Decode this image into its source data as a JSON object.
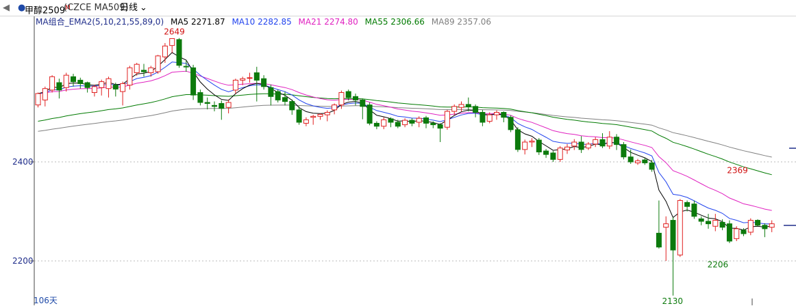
{
  "toolbar": {
    "back_icon": "triangle-left-icon",
    "symbol_name": "甲醇2509",
    "symbol_superscript": "M",
    "code": "(CZCE MA509)",
    "period": "日线",
    "dropdown_icon": "chevron-down-icon"
  },
  "legend": {
    "group_name": "MA组合_EMA2(5,10,21,55,89,0)",
    "items": [
      {
        "label": "MA5 2271.87",
        "color": "#000000"
      },
      {
        "label": "MA10 2282.85",
        "color": "#2244ee"
      },
      {
        "label": "MA21 2274.80",
        "color": "#e020c0"
      },
      {
        "label": "MA55 2306.66",
        "color": "#007a00"
      },
      {
        "label": "MA89 2357.06",
        "color": "#7f7f7f"
      }
    ]
  },
  "bottom_label": "106天",
  "colors": {
    "up": "#e02020",
    "down": "#0c7a0c",
    "grid": "#b8b8b8"
  },
  "chart_data": {
    "type": "candlestick",
    "title": "",
    "y_ticks": [
      2200,
      2400
    ],
    "grid": "dashed-horizontal",
    "annotations": [
      {
        "label": "2649",
        "value": 2649,
        "type": "high"
      },
      {
        "label": "2130",
        "value": 2130,
        "type": "low"
      },
      {
        "label": "2369",
        "value": 2369,
        "type": "high"
      },
      {
        "label": "2206",
        "value": 2206,
        "type": "low"
      }
    ],
    "candles": [
      [
        2515,
        2538,
        2510,
        2540
      ],
      [
        2525,
        2548,
        2512,
        2552
      ],
      [
        2545,
        2572,
        2540,
        2575
      ],
      [
        2560,
        2545,
        2528,
        2568
      ],
      [
        2550,
        2575,
        2542,
        2580
      ],
      [
        2572,
        2562,
        2552,
        2578
      ],
      [
        2565,
        2558,
        2548,
        2570
      ],
      [
        2560,
        2550,
        2540,
        2562
      ],
      [
        2540,
        2552,
        2532,
        2556
      ],
      [
        2550,
        2562,
        2534,
        2566
      ],
      [
        2548,
        2568,
        2530,
        2572
      ],
      [
        2555,
        2547,
        2532,
        2560
      ],
      [
        2542,
        2558,
        2514,
        2562
      ],
      [
        2555,
        2590,
        2546,
        2594
      ],
      [
        2580,
        2597,
        2574,
        2600
      ],
      [
        2585,
        2582,
        2572,
        2598
      ],
      [
        2580,
        2590,
        2572,
        2594
      ],
      [
        2582,
        2614,
        2578,
        2616
      ],
      [
        2612,
        2634,
        2600,
        2640
      ],
      [
        2635,
        2649,
        2620,
        2649
      ],
      [
        2647,
        2595,
        2590,
        2650
      ],
      [
        2593,
        2592,
        2582,
        2604
      ],
      [
        2590,
        2535,
        2525,
        2596
      ],
      [
        2540,
        2520,
        2514,
        2546
      ],
      [
        2520,
        2518,
        2506,
        2530
      ],
      [
        2514,
        2512,
        2502,
        2522
      ],
      [
        2518,
        2508,
        2485,
        2524
      ],
      [
        2510,
        2520,
        2498,
        2526
      ],
      [
        2545,
        2565,
        2538,
        2568
      ],
      [
        2565,
        2568,
        2555,
        2572
      ],
      [
        2570,
        2570,
        2560,
        2580
      ],
      [
        2580,
        2565,
        2522,
        2592
      ],
      [
        2568,
        2552,
        2546,
        2575
      ],
      [
        2550,
        2532,
        2514,
        2556
      ],
      [
        2542,
        2525,
        2520,
        2546
      ],
      [
        2530,
        2522,
        2514,
        2542
      ],
      [
        2522,
        2505,
        2495,
        2526
      ],
      [
        2505,
        2480,
        2475,
        2512
      ],
      [
        2478,
        2485,
        2472,
        2490
      ],
      [
        2490,
        2492,
        2475,
        2495
      ],
      [
        2492,
        2496,
        2485,
        2498
      ],
      [
        2495,
        2500,
        2482,
        2504
      ],
      [
        2505,
        2515,
        2496,
        2518
      ],
      [
        2515,
        2540,
        2507,
        2544
      ],
      [
        2542,
        2530,
        2524,
        2546
      ],
      [
        2532,
        2525,
        2514,
        2538
      ],
      [
        2525,
        2512,
        2486,
        2528
      ],
      [
        2515,
        2478,
        2474,
        2520
      ],
      [
        2478,
        2472,
        2466,
        2482
      ],
      [
        2472,
        2485,
        2466,
        2490
      ],
      [
        2487,
        2480,
        2470,
        2490
      ],
      [
        2480,
        2472,
        2468,
        2485
      ],
      [
        2475,
        2484,
        2470,
        2488
      ],
      [
        2484,
        2478,
        2472,
        2488
      ],
      [
        2480,
        2488,
        2470,
        2492
      ],
      [
        2489,
        2478,
        2468,
        2493
      ],
      [
        2478,
        2475,
        2468,
        2482
      ],
      [
        2475,
        2468,
        2440,
        2478
      ],
      [
        2470,
        2502,
        2465,
        2505
      ],
      [
        2502,
        2512,
        2495,
        2516
      ],
      [
        2510,
        2516,
        2502,
        2522
      ],
      [
        2516,
        2512,
        2502,
        2530
      ],
      [
        2512,
        2500,
        2490,
        2516
      ],
      [
        2500,
        2480,
        2472,
        2505
      ],
      [
        2482,
        2495,
        2478,
        2500
      ],
      [
        2495,
        2500,
        2485,
        2504
      ],
      [
        2500,
        2490,
        2480,
        2502
      ],
      [
        2490,
        2465,
        2460,
        2494
      ],
      [
        2465,
        2425,
        2420,
        2470
      ],
      [
        2425,
        2440,
        2415,
        2445
      ],
      [
        2440,
        2442,
        2430,
        2448
      ],
      [
        2444,
        2420,
        2414,
        2448
      ],
      [
        2422,
        2415,
        2408,
        2426
      ],
      [
        2418,
        2405,
        2400,
        2422
      ],
      [
        2405,
        2428,
        2400,
        2432
      ],
      [
        2424,
        2430,
        2416,
        2436
      ],
      [
        2432,
        2440,
        2424,
        2446
      ],
      [
        2440,
        2425,
        2418,
        2452
      ],
      [
        2428,
        2436,
        2424,
        2440
      ],
      [
        2436,
        2445,
        2430,
        2450
      ],
      [
        2445,
        2432,
        2428,
        2458
      ],
      [
        2432,
        2450,
        2426,
        2462
      ],
      [
        2450,
        2435,
        2424,
        2456
      ],
      [
        2435,
        2410,
        2405,
        2440
      ],
      [
        2410,
        2400,
        2396,
        2425
      ],
      [
        2398,
        2402,
        2394,
        2406
      ],
      [
        2404,
        2398,
        2394,
        2408
      ],
      [
        2398,
        2385,
        2380,
        2404
      ],
      [
        2256,
        2228,
        2225,
        2322
      ],
      [
        2268,
        2275,
        2200,
        2290
      ],
      [
        2282,
        2222,
        2130,
        2288
      ],
      [
        2212,
        2322,
        2208,
        2325
      ],
      [
        2318,
        2310,
        2300,
        2322
      ],
      [
        2315,
        2290,
        2285,
        2322
      ],
      [
        2285,
        2280,
        2272,
        2290
      ],
      [
        2280,
        2275,
        2265,
        2295
      ],
      [
        2270,
        2282,
        2260,
        2295
      ],
      [
        2278,
        2268,
        2262,
        2284
      ],
      [
        2275,
        2240,
        2236,
        2282
      ],
      [
        2245,
        2265,
        2240,
        2270
      ],
      [
        2262,
        2255,
        2250,
        2266
      ],
      [
        2258,
        2282,
        2252,
        2286
      ],
      [
        2282,
        2272,
        2270,
        2284
      ],
      [
        2272,
        2265,
        2248,
        2276
      ],
      [
        2268,
        2275,
        2258,
        2282
      ]
    ]
  }
}
